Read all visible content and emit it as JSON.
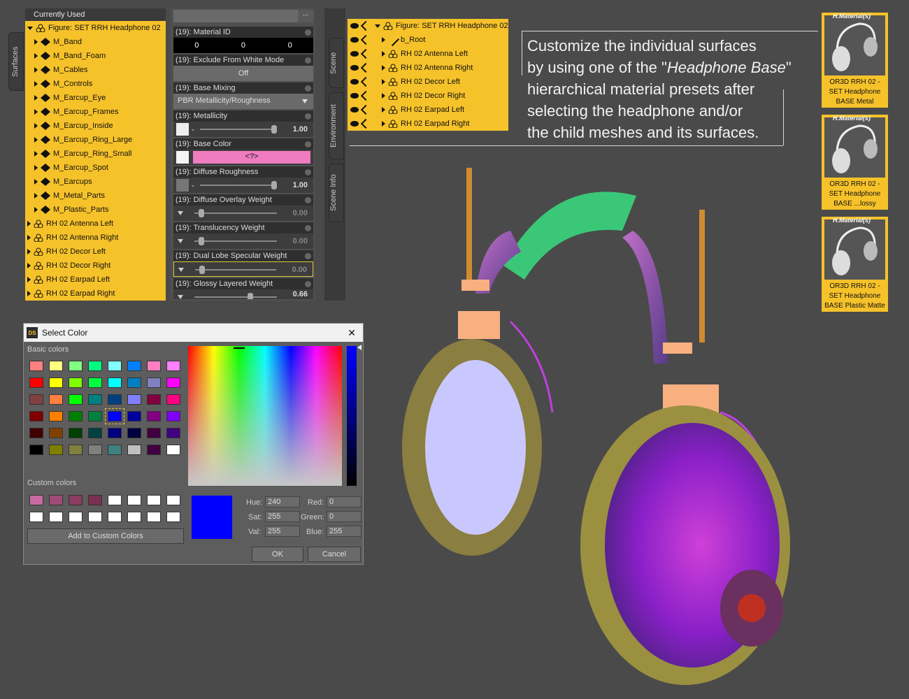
{
  "surfaces_panel": {
    "side_tab": "Surfaces",
    "header": "Currently Used",
    "figure": "Figure: SET RRH Headphone 02",
    "materials": [
      "M_Band",
      "M_Band_Foam",
      "M_Cables",
      "M_Controls",
      "M_Earcup_Eye",
      "M_Earcup_Frames",
      "M_Earcup_Inside",
      "M_Earcup_Ring_Large",
      "M_Earcup_Ring_Small",
      "M_Earcup_Spot",
      "M_Earcups",
      "M_Metal_Parts",
      "M_Plastic_Parts"
    ],
    "children": [
      "RH 02 Antenna Left",
      "RH 02 Antenna Right",
      "RH 02 Decor Left",
      "RH 02 Decor Right",
      "RH 02 Earpad Left",
      "RH 02 Earpad Right"
    ]
  },
  "properties": {
    "ellipsis": "...",
    "material_id": {
      "label": "(19): Material ID",
      "v1": "0",
      "v2": "0",
      "v3": "0"
    },
    "exclude_white": {
      "label": "(19): Exclude From White Mode",
      "value": "Off"
    },
    "base_mixing": {
      "label": "(19): Base Mixing",
      "value": "PBR Metallicity/Roughness"
    },
    "metallicity": {
      "label": "(19): Metallicity",
      "value": "1.00"
    },
    "base_color": {
      "label": "(19): Base Color",
      "value": "<?>"
    },
    "diffuse_roughness": {
      "label": "(19): Diffuse Roughness",
      "value": "1.00"
    },
    "diffuse_overlay": {
      "label": "(19): Diffuse Overlay Weight",
      "value": "0.00"
    },
    "translucency": {
      "label": "(19): Translucency Weight",
      "value": "0.00"
    },
    "dual_lobe": {
      "label": "(19): Dual Lobe Specular Weight",
      "value": "0.00"
    },
    "glossy_layered": {
      "label": "(19): Glossy Layered Weight",
      "value": "0.66"
    }
  },
  "scene_tabs": [
    "Scene",
    "Environment",
    "Scene Info"
  ],
  "scene_panel": {
    "figure": "Figure: SET RRH Headphone 02",
    "items": [
      "b_Root",
      "RH 02 Antenna Left",
      "RH 02 Antenna Right",
      "RH 02 Decor Left",
      "RH 02 Decor Right",
      "RH 02 Earpad Left",
      "RH 02 Earpad Right"
    ]
  },
  "callout": {
    "line1": "Customize the individual surfaces",
    "line2_pre": "by using one of the \"",
    "line2_em": "Headphone Base",
    "line2_post": "\"",
    "line3": "hierarchical material presets after",
    "line4": "selecting the headphone and/or",
    "line5": "the child meshes and its surfaces."
  },
  "presets": [
    {
      "tag": "H.Material(s)",
      "l1": "OR3D RRH 02 -",
      "l2": "SET Headphone",
      "l3": "BASE Metal"
    },
    {
      "tag": "H.Material(s)",
      "l1": "OR3D RRH 02 -",
      "l2": "SET Headphone",
      "l3": "BASE ...lossy"
    },
    {
      "tag": "H.Material(s)",
      "l1": "OR3D RRH 02 -",
      "l2": "SET Headphone",
      "l3": "BASE Plastic Matte"
    }
  ],
  "dialog": {
    "logo": "DS",
    "title": "Select Color",
    "close": "✕",
    "basic_colors_label": "Basic colors",
    "custom_colors_label": "Custom colors",
    "add_custom": "Add to Custom Colors",
    "hue_label": "Hue:",
    "hue": "240",
    "sat_label": "Sat:",
    "sat": "255",
    "val_label": "Val:",
    "val": "255",
    "red_label": "Red:",
    "red": "0",
    "green_label": "Green:",
    "green": "0",
    "blue_label": "Blue:",
    "blue": "255",
    "ok": "OK",
    "cancel": "Cancel",
    "current_color": "#0000ff",
    "basic_colors": [
      "#ff8080",
      "#ffff80",
      "#80ff80",
      "#00ff80",
      "#80ffff",
      "#0080ff",
      "#ff80c0",
      "#ff80ff",
      "#ff0000",
      "#ffff00",
      "#80ff00",
      "#00ff40",
      "#00ffff",
      "#0080c0",
      "#8080c0",
      "#ff00ff",
      "#804040",
      "#ff8040",
      "#00ff00",
      "#008080",
      "#004080",
      "#8080ff",
      "#800040",
      "#ff0080",
      "#800000",
      "#ff8000",
      "#008000",
      "#008040",
      "#0000ff",
      "#0000a0",
      "#800080",
      "#8000ff",
      "#400000",
      "#804000",
      "#004000",
      "#004040",
      "#000080",
      "#000040",
      "#400040",
      "#400080",
      "#000000",
      "#808000",
      "#808040",
      "#808080",
      "#408080",
      "#c0c0c0",
      "#400040",
      "#ffffff"
    ],
    "custom_colors": [
      "#c86aa0",
      "#a04c78",
      "#8a3c62",
      "#7a3050",
      "#ffffff",
      "#ffffff",
      "#ffffff",
      "#ffffff",
      "#ffffff",
      "#ffffff",
      "#ffffff",
      "#ffffff",
      "#ffffff",
      "#ffffff",
      "#ffffff",
      "#ffffff"
    ]
  }
}
